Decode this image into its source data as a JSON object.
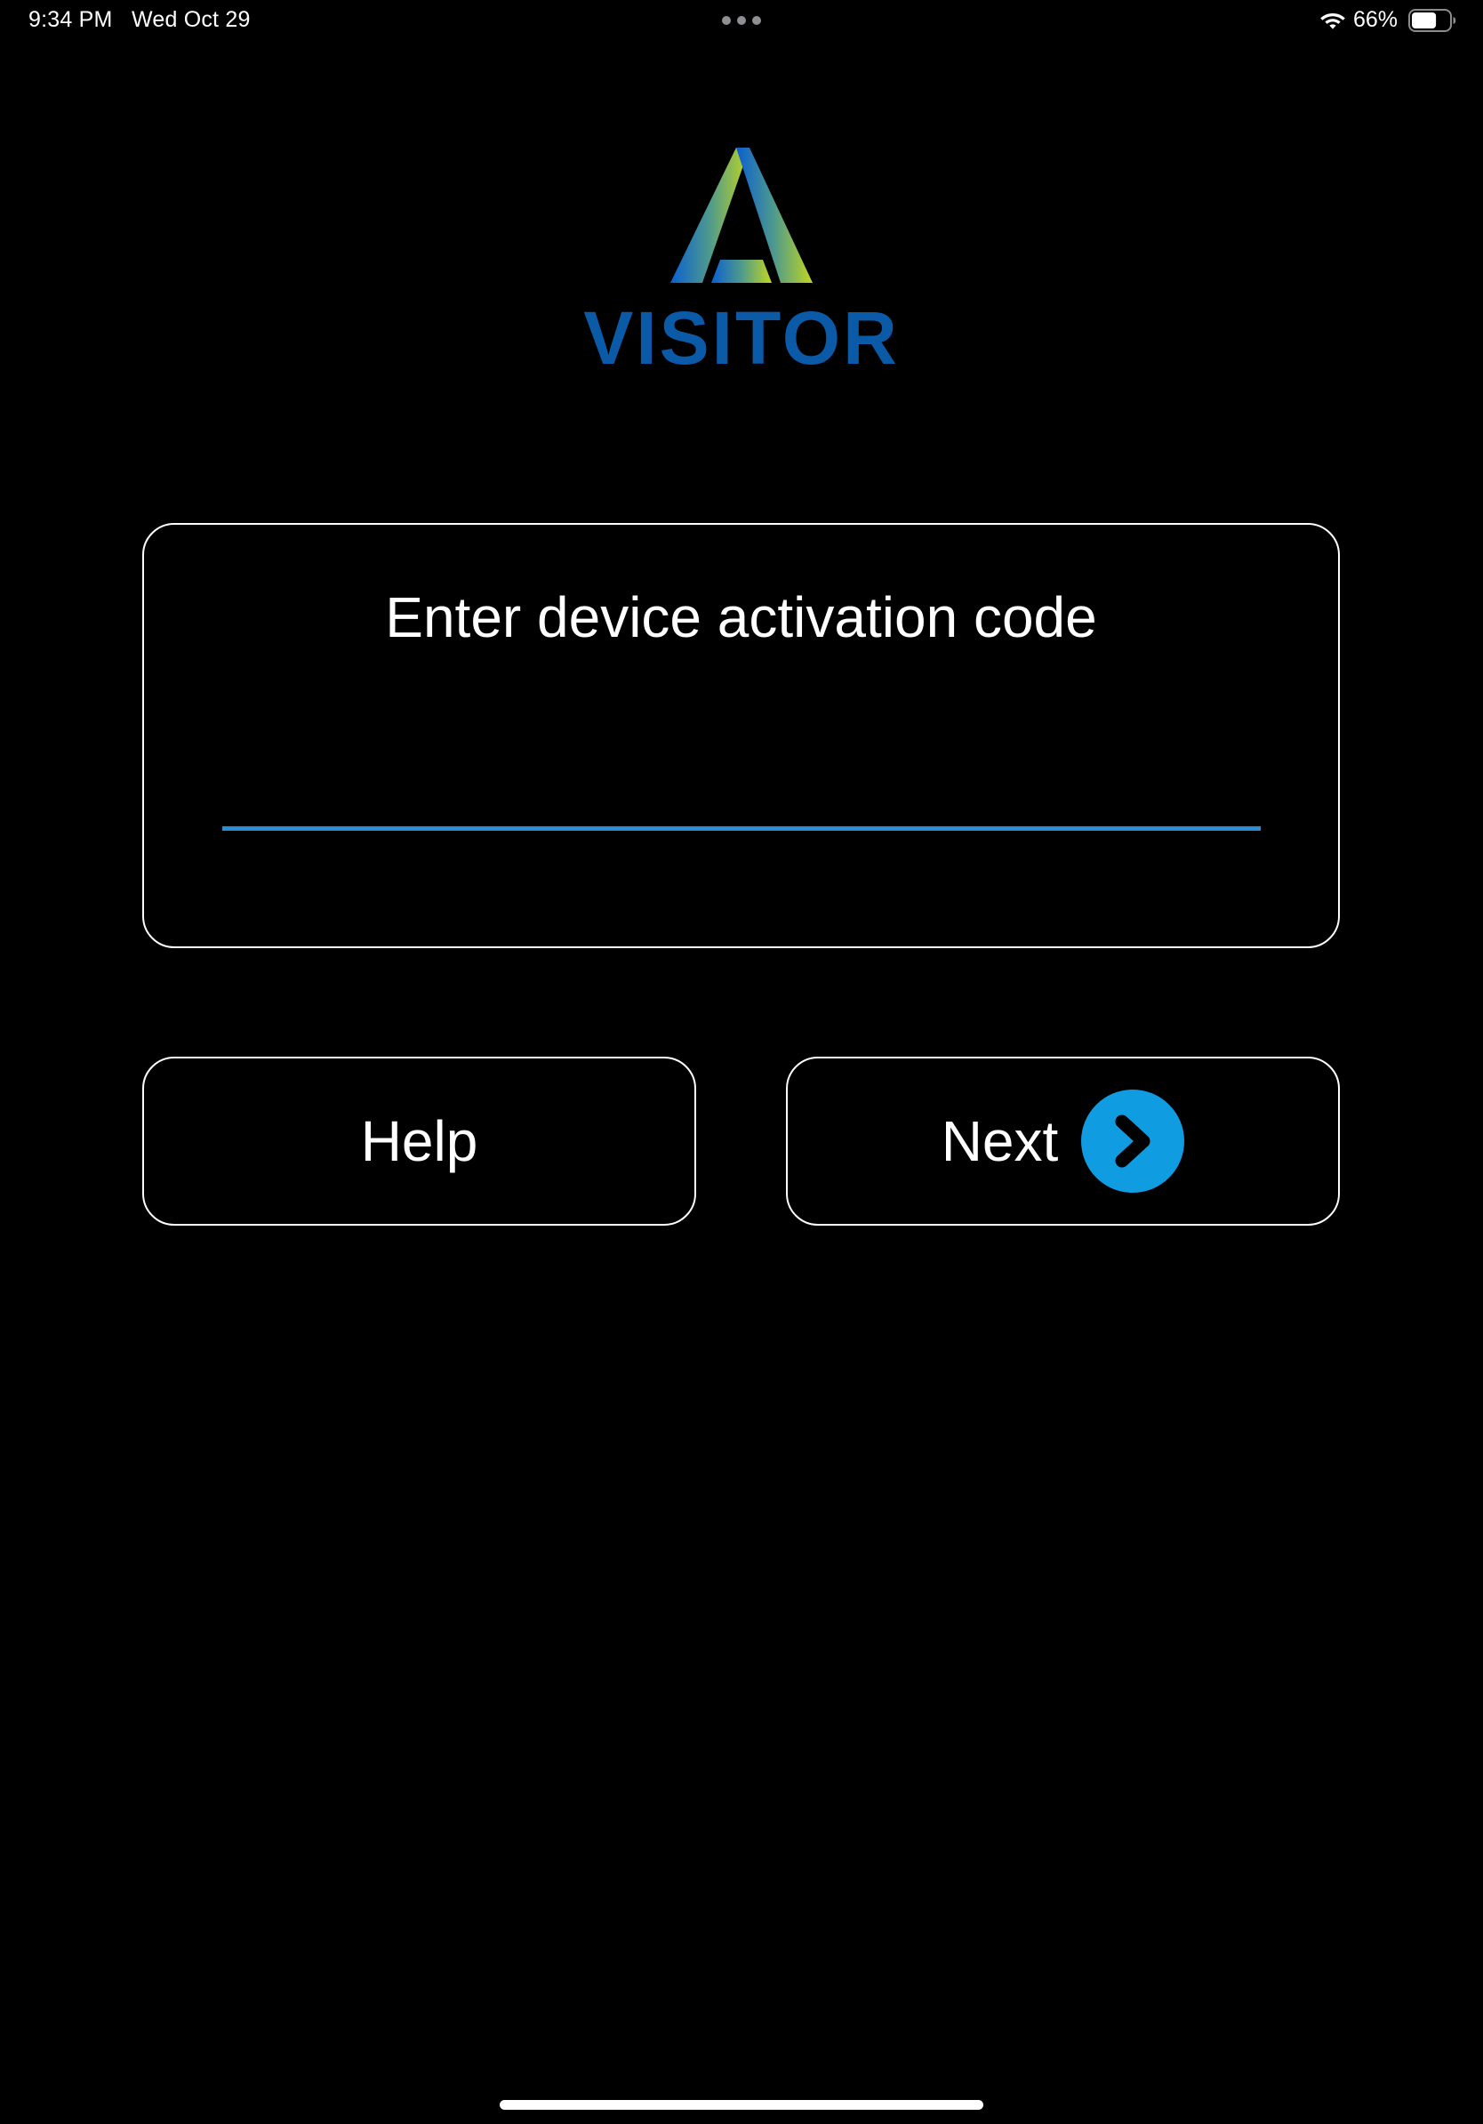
{
  "status_bar": {
    "time": "9:34 PM",
    "date": "Wed Oct 29",
    "battery_percent": "66%",
    "battery_level": 0.66,
    "wifi_icon": "wifi-icon",
    "battery_icon": "battery-icon",
    "multitask_icon": "ellipsis-icon"
  },
  "logo": {
    "word": "VISITOR",
    "mark_icon": "a-logo-icon",
    "colors": {
      "word": "#0a5aa8",
      "gradient_start": "#0a5fd1",
      "gradient_end": "#c2d620"
    }
  },
  "activation": {
    "title": "Enter device activation code",
    "input_value": "",
    "input_placeholder": "",
    "underline_color": "#2a8ed4"
  },
  "buttons": {
    "help_label": "Help",
    "next_label": "Next",
    "next_icon": "chevron-right-circle-icon",
    "next_icon_color": "#109ce0"
  }
}
